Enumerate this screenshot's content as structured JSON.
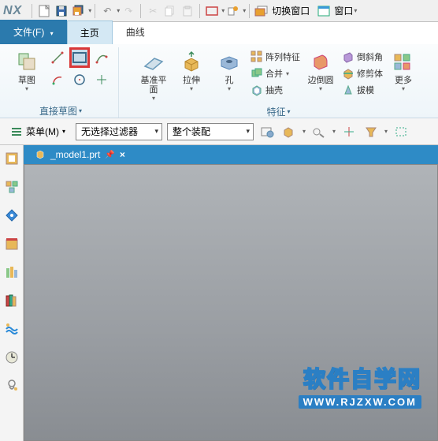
{
  "app_name": "NX",
  "titlebar": {
    "switch_window": "切换窗口",
    "window_menu": "窗口"
  },
  "tabs": {
    "file": "文件(F)",
    "home": "主页",
    "curve": "曲线"
  },
  "ribbon": {
    "sketch": {
      "label": "草图",
      "group_label": "直接草图"
    },
    "datum_plane": "基准平面",
    "extrude": "拉伸",
    "hole": "孔",
    "pattern_feature": "阵列特征",
    "unite": "合并",
    "shell": "抽壳",
    "edge_blend": "边倒圆",
    "chamfer": "倒斜角",
    "trim_body": "修剪体",
    "draft": "拔模",
    "more": "更多",
    "feature_group": "特征"
  },
  "filterbar": {
    "menu": "菜单(M)",
    "no_filter": "无选择过滤器",
    "assembly": "整个装配"
  },
  "document": {
    "name": "_model1.prt"
  },
  "watermark": {
    "main": "软件自学网",
    "sub": "WWW.RJZXW.COM"
  }
}
